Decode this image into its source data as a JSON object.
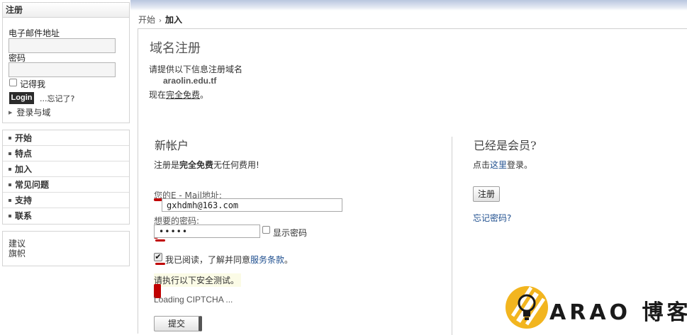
{
  "sidebar": {
    "login": {
      "title": "注册",
      "email_label": "电子邮件地址",
      "email_value": "",
      "password_label": "密码",
      "password_value": "",
      "remember_label": "记得我",
      "login_button": "Login",
      "forgot_link": "...忘记了?",
      "domain_login": "登录与域"
    },
    "nav": [
      "开始",
      "特点",
      "加入",
      "常见问题",
      "支持",
      "联系"
    ],
    "extra_links": [
      "建议",
      "旗帜"
    ]
  },
  "breadcrumb": {
    "home": "开始",
    "current": "加入"
  },
  "main": {
    "title": "域名注册",
    "intro": "请提供以下信息注册域名",
    "domain": "araolin.edu.tf",
    "free_prefix": "现在",
    "free_link": "完全免费",
    "free_suffix": "。"
  },
  "new_account": {
    "title": "新帐户",
    "subtitle_prefix": "注册是",
    "subtitle_bold": "完全免费",
    "subtitle_suffix": "无任何费用!",
    "email_label": "您的E - Mail地址:",
    "email_value": "gxhdmh@163.com",
    "password_label": "想要的密码:",
    "password_value": "•••••",
    "show_password_label": "显示密码",
    "terms_prefix": "我已阅读，了解并同意",
    "terms_link": "服务条款",
    "terms_suffix": "。",
    "captcha_hint": "请执行以下安全测试。",
    "captcha_loading": "Loading CIPTCHA ...",
    "submit_button": "提交"
  },
  "member": {
    "title": "已经是会员?",
    "login_prefix": "点击",
    "login_link": "这里",
    "login_suffix": "登录。",
    "register_button": "注册",
    "forgot_link": "忘记密码?"
  },
  "watermark": {
    "text": "ARAO 博客"
  },
  "colors": {
    "marker": "#c00000",
    "link": "#1f4f8f",
    "logo_yellow": "#f2b51f"
  }
}
